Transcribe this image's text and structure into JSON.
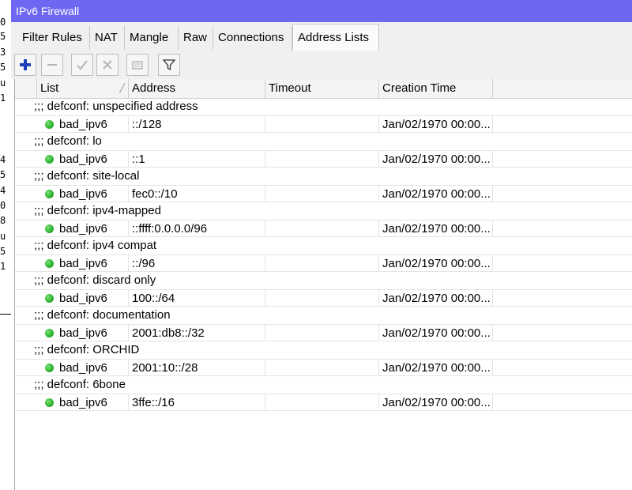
{
  "window": {
    "title": "IPv6 Firewall"
  },
  "background_fragments": [
    "0",
    "5",
    "3",
    "5",
    "u",
    "1",
    "4",
    "5",
    "4",
    "0",
    "8",
    "u",
    "5",
    "1"
  ],
  "tabs": [
    {
      "label": "Filter Rules",
      "active": false
    },
    {
      "label": "NAT",
      "active": false
    },
    {
      "label": "Mangle",
      "active": false
    },
    {
      "label": "Raw",
      "active": false
    },
    {
      "label": "Connections",
      "active": false
    },
    {
      "label": "Address Lists",
      "active": true
    }
  ],
  "toolbar": {
    "buttons": [
      {
        "icon": "plus-icon",
        "enabled": true
      },
      {
        "icon": "minus-icon",
        "enabled": false
      },
      {
        "icon": "check-icon",
        "enabled": false
      },
      {
        "icon": "cross-icon",
        "enabled": false
      },
      {
        "icon": "comment-icon",
        "enabled": false
      },
      {
        "icon": "filter-icon",
        "enabled": true
      }
    ]
  },
  "table": {
    "columns": [
      "List",
      "Address",
      "Timeout",
      "Creation Time"
    ],
    "rows": [
      {
        "comment": ";;; defconf: unspecified address",
        "list": "bad_ipv6",
        "address": "::/128",
        "timeout": "",
        "created": "Jan/02/1970 00:00..."
      },
      {
        "comment": ";;; defconf: lo",
        "list": "bad_ipv6",
        "address": "::1",
        "timeout": "",
        "created": "Jan/02/1970 00:00..."
      },
      {
        "comment": ";;; defconf: site-local",
        "list": "bad_ipv6",
        "address": "fec0::/10",
        "timeout": "",
        "created": "Jan/02/1970 00:00..."
      },
      {
        "comment": ";;; defconf: ipv4-mapped",
        "list": "bad_ipv6",
        "address": "::ffff:0.0.0.0/96",
        "timeout": "",
        "created": "Jan/02/1970 00:00..."
      },
      {
        "comment": ";;; defconf: ipv4 compat",
        "list": "bad_ipv6",
        "address": "::/96",
        "timeout": "",
        "created": "Jan/02/1970 00:00..."
      },
      {
        "comment": ";;; defconf: discard only",
        "list": "bad_ipv6",
        "address": "100::/64",
        "timeout": "",
        "created": "Jan/02/1970 00:00..."
      },
      {
        "comment": ";;; defconf: documentation",
        "list": "bad_ipv6",
        "address": "2001:db8::/32",
        "timeout": "",
        "created": "Jan/02/1970 00:00..."
      },
      {
        "comment": ";;; defconf: ORCHID",
        "list": "bad_ipv6",
        "address": "2001:10::/28",
        "timeout": "",
        "created": "Jan/02/1970 00:00..."
      },
      {
        "comment": ";;; defconf: 6bone",
        "list": "bad_ipv6",
        "address": "3ffe::/16",
        "timeout": "",
        "created": "Jan/02/1970 00:00..."
      }
    ]
  },
  "colors": {
    "titlebar": "#6d67f2",
    "status_enabled": "#2fb52f",
    "accent_plus": "#1a3db8"
  }
}
